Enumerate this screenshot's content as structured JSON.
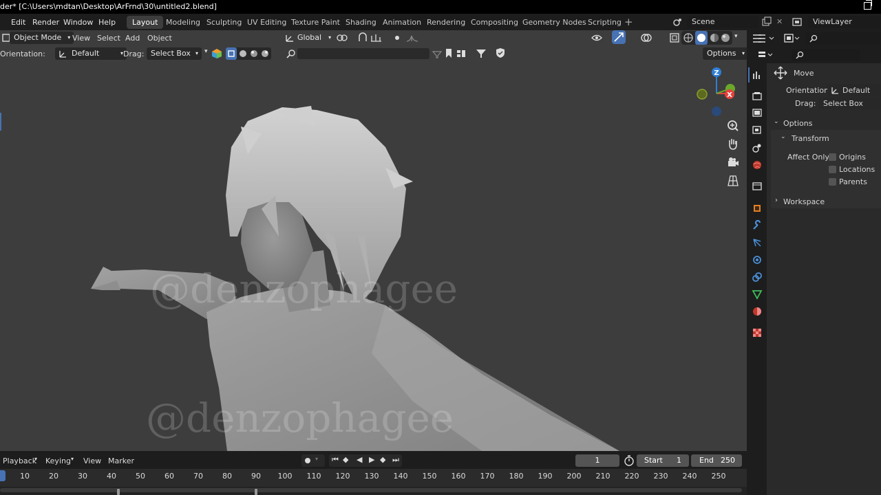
{
  "window": {
    "title": "der* [C:\\Users\\mdtan\\Desktop\\ArFrnd\\30\\untitled2.blend]"
  },
  "menu": [
    "Edit",
    "Render",
    "Window",
    "Help"
  ],
  "workspaces": [
    "Layout",
    "Modeling",
    "Sculpting",
    "UV Editing",
    "Texture Paint",
    "Shading",
    "Animation",
    "Rendering",
    "Compositing",
    "Geometry Nodes",
    "Scripting"
  ],
  "active_workspace": "Layout",
  "scene": {
    "name": "Scene",
    "view_layer": "ViewLayer"
  },
  "viewport_header": {
    "mode": "Object Mode",
    "menus": [
      "View",
      "Select",
      "Add",
      "Object"
    ],
    "transform_orientation": "Global"
  },
  "tool_header": {
    "orientation_label": "Orientation:",
    "orientation_value": "Default",
    "drag_label": "Drag:",
    "drag_value": "Select Box",
    "options_label": "Options"
  },
  "viewport": {
    "watermark": "@denzophagee"
  },
  "properties": {
    "tool_name": "Move",
    "orientation_label": "Orientation",
    "orientation_value": "Default",
    "drag_label": "Drag:",
    "drag_value": "Select Box",
    "options_label": "Options",
    "transform_label": "Transform",
    "affect_only_label": "Affect Only",
    "affect_only": [
      {
        "label": "Origins",
        "checked": false
      },
      {
        "label": "Locations",
        "checked": false
      },
      {
        "label": "Parents",
        "checked": false
      }
    ],
    "workspace_label": "Workspace"
  },
  "timeline": {
    "menus": [
      "Playback",
      "Keying",
      "View",
      "Marker"
    ],
    "current_frame": "1",
    "start_label": "Start",
    "start": "1",
    "end_label": "End",
    "end": "250",
    "ruler": [
      "10",
      "20",
      "30",
      "40",
      "50",
      "60",
      "70",
      "80",
      "90",
      "100",
      "110",
      "120",
      "130",
      "140",
      "150",
      "160",
      "170",
      "180",
      "190",
      "200",
      "210",
      "220",
      "230",
      "240",
      "250"
    ]
  },
  "colors": {
    "accent": "#4772b3",
    "axis_x": "#e8413c",
    "axis_y": "#6aa82b",
    "axis_z": "#2e7fd6"
  }
}
